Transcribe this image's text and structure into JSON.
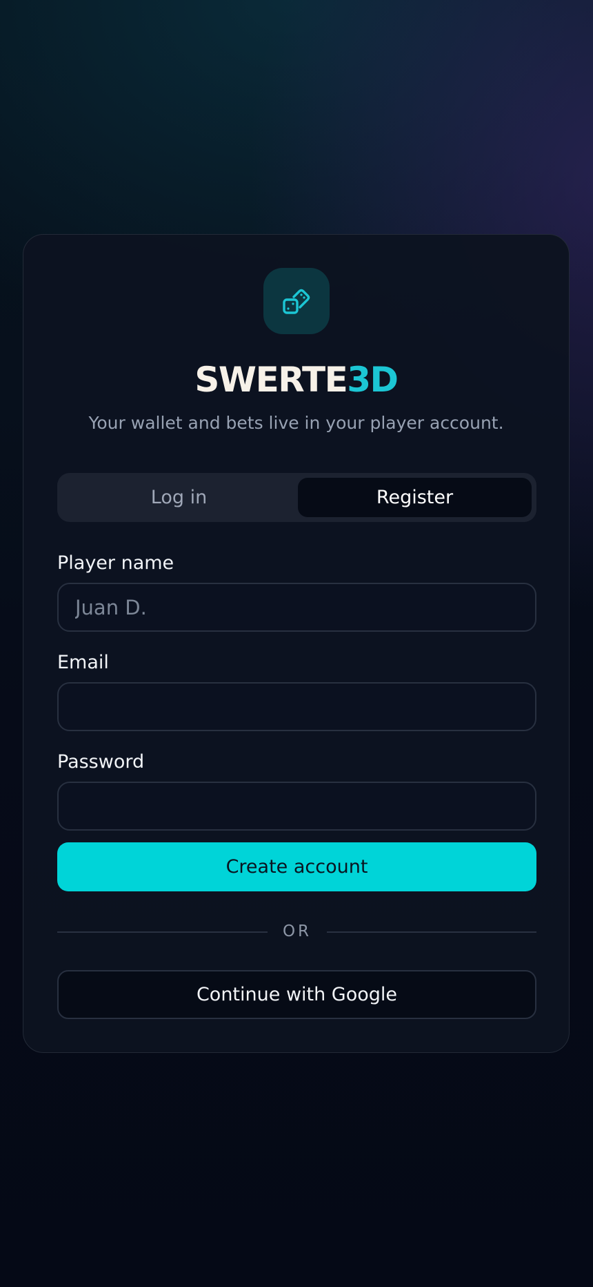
{
  "brand": {
    "name_part1": "SWERTE",
    "name_part2": "3D",
    "logo_icon": "dice-icon",
    "accent_color": "#1cc6d4"
  },
  "tagline": "Your wallet and bets live in your player account.",
  "tabs": [
    {
      "label": "Log in",
      "active": false
    },
    {
      "label": "Register",
      "active": true
    }
  ],
  "form": {
    "player_name": {
      "label": "Player name",
      "placeholder": "Juan D.",
      "value": ""
    },
    "email": {
      "label": "Email",
      "placeholder": "",
      "value": ""
    },
    "password": {
      "label": "Password",
      "placeholder": "",
      "value": ""
    },
    "submit_label": "Create account"
  },
  "divider_text": "OR",
  "google_button_label": "Continue with Google",
  "colors": {
    "primary_button": "#00d4d8",
    "card_background": "#0d1320",
    "page_background": "#050916"
  }
}
